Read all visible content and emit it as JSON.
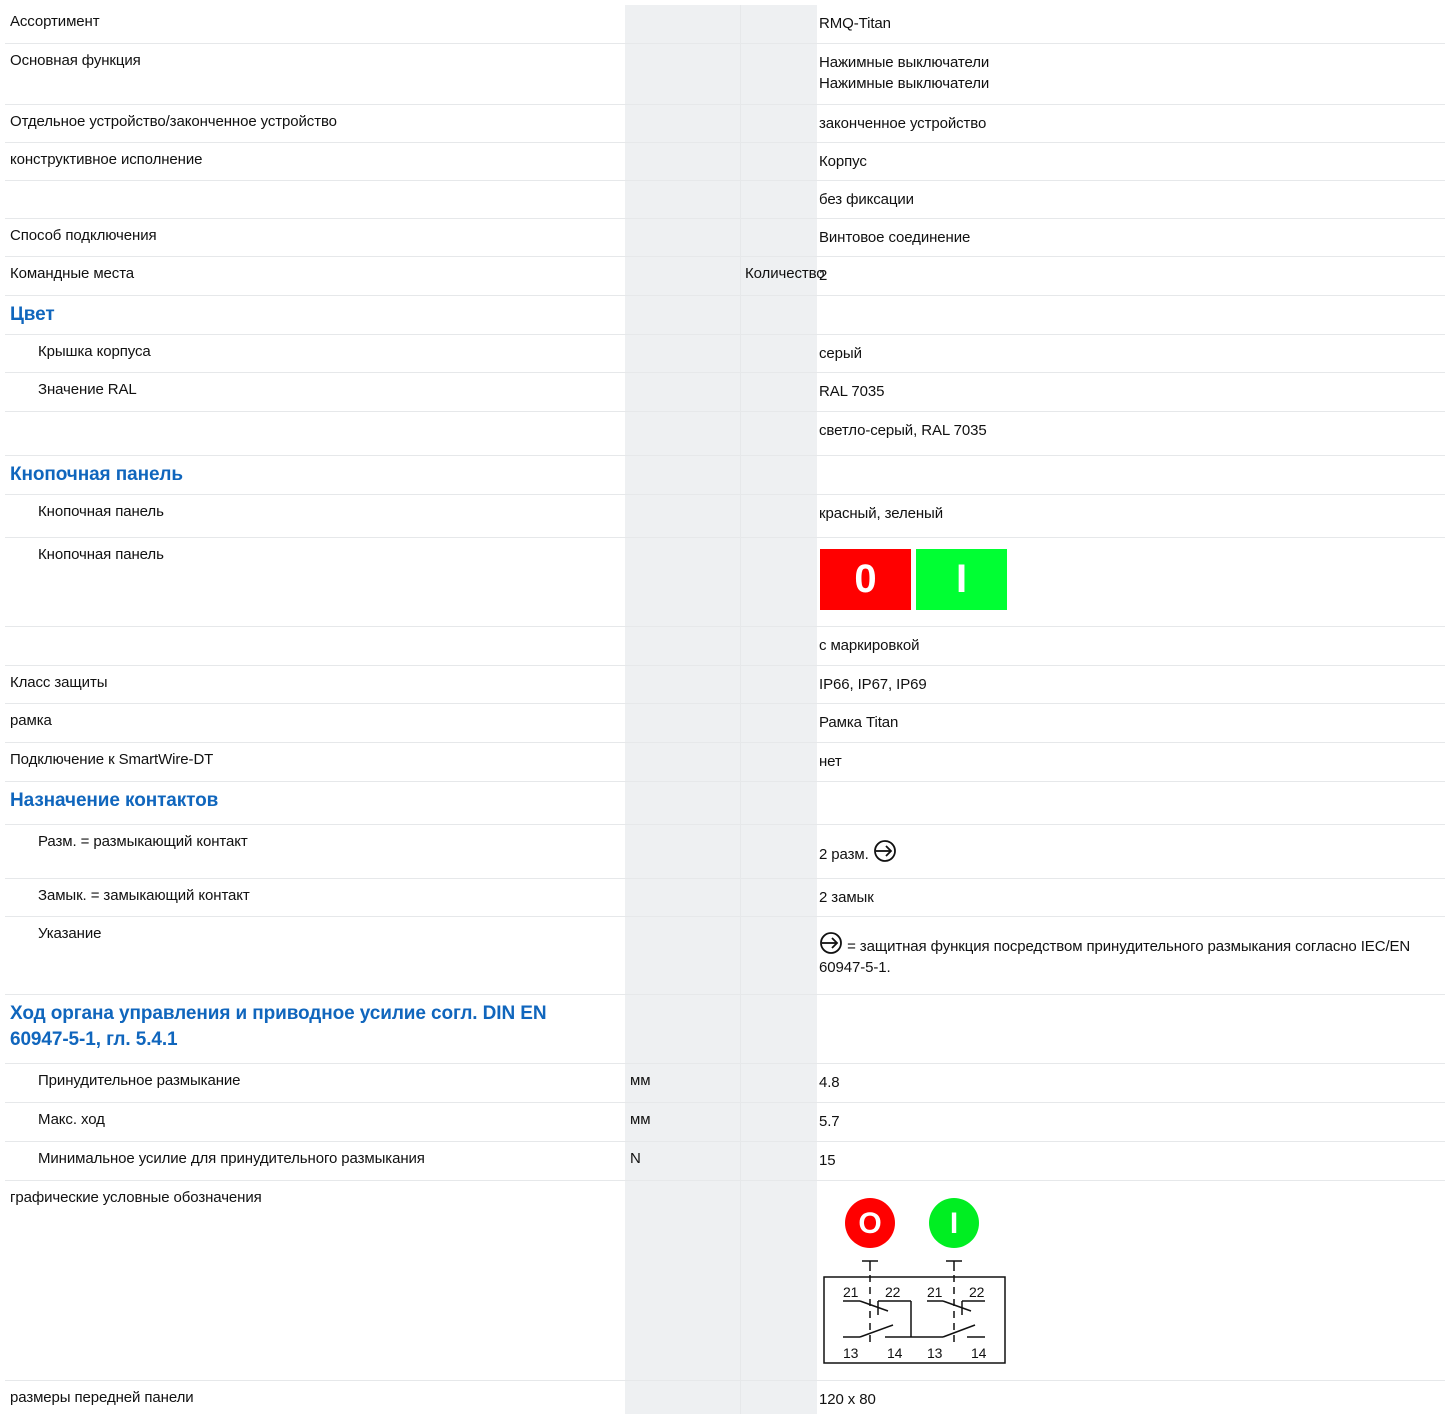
{
  "rows": {
    "assortment": {
      "label": "Ассортимент",
      "value": "RMQ-Titan"
    },
    "main_function": {
      "label": "Основная функция",
      "value1": "Нажимные выключатели",
      "value2": "Нажимные выключатели"
    },
    "device_type": {
      "label": "Отдельное устройство/законченное устройство",
      "value": "законченное устройство"
    },
    "design": {
      "label": "конструктивное исполнение",
      "value": "Корпус"
    },
    "latching": {
      "value": "без фиксации"
    },
    "connection": {
      "label": "Способ подключения",
      "value": "Винтовое соединение"
    },
    "command_points": {
      "label": "Командные места",
      "qualifier": "Количество",
      "value": "2"
    },
    "color_section": {
      "label": "Цвет"
    },
    "housing_cover": {
      "label": "Крышка корпуса",
      "value": "серый"
    },
    "ral": {
      "label": "Значение RAL",
      "value": "RAL 7035"
    },
    "ral_text": {
      "value": "светло-серый, RAL 7035"
    },
    "button_section": {
      "label": "Кнопочная панель"
    },
    "button_colors": {
      "label": "Кнопочная панель",
      "value": "красный, зеленый"
    },
    "button_image": {
      "label": "Кнопочная панель",
      "left_symbol": "0",
      "right_symbol": "I"
    },
    "marking": {
      "value": "с маркировкой"
    },
    "protection": {
      "label": "Класс защиты",
      "value": "IP66, IP67, IP69"
    },
    "frame": {
      "label": "рамка",
      "value": "Рамка Titan"
    },
    "smartwire": {
      "label": "Подключение к SmartWire-DT",
      "value": "нет"
    },
    "contacts_section": {
      "label": "Назначение контактов"
    },
    "nc": {
      "label": "Разм. = размыкающий контакт",
      "value": "2 разм."
    },
    "no": {
      "label": "Замык. = замыкающий контакт",
      "value": "2 замык"
    },
    "note": {
      "label": "Указание",
      "value": "= защитная функция посредством принудительного размыкания согласно IEC/EN 60947-5-1."
    },
    "travel_section": {
      "label": "Ход органа управления и приводное усилие согл. DIN EN 60947-5-1, гл. 5.4.1"
    },
    "positive_opening": {
      "label": "Принудительное размыкание",
      "unit": "мм",
      "value": "4.8"
    },
    "max_travel": {
      "label": "Макс. ход",
      "unit": "мм",
      "value": "5.7"
    },
    "min_force": {
      "label": "Минимальное усилие для принудительного размыкания",
      "unit": "N",
      "value": "15"
    },
    "symbols": {
      "label": "графические условные обозначения",
      "left_button": "O",
      "right_button": "I",
      "terminals_top": [
        "21",
        "22",
        "21",
        "22"
      ],
      "terminals_bottom": [
        "13",
        "14",
        "13",
        "14"
      ]
    },
    "front_size": {
      "label": "размеры передней панели",
      "value": "120 x 80"
    }
  },
  "colors": {
    "section_heading": "#1066bd",
    "button_red": "#ff0000",
    "button_green": "#00ff33",
    "unit_column_bg": "#eef0f2"
  }
}
